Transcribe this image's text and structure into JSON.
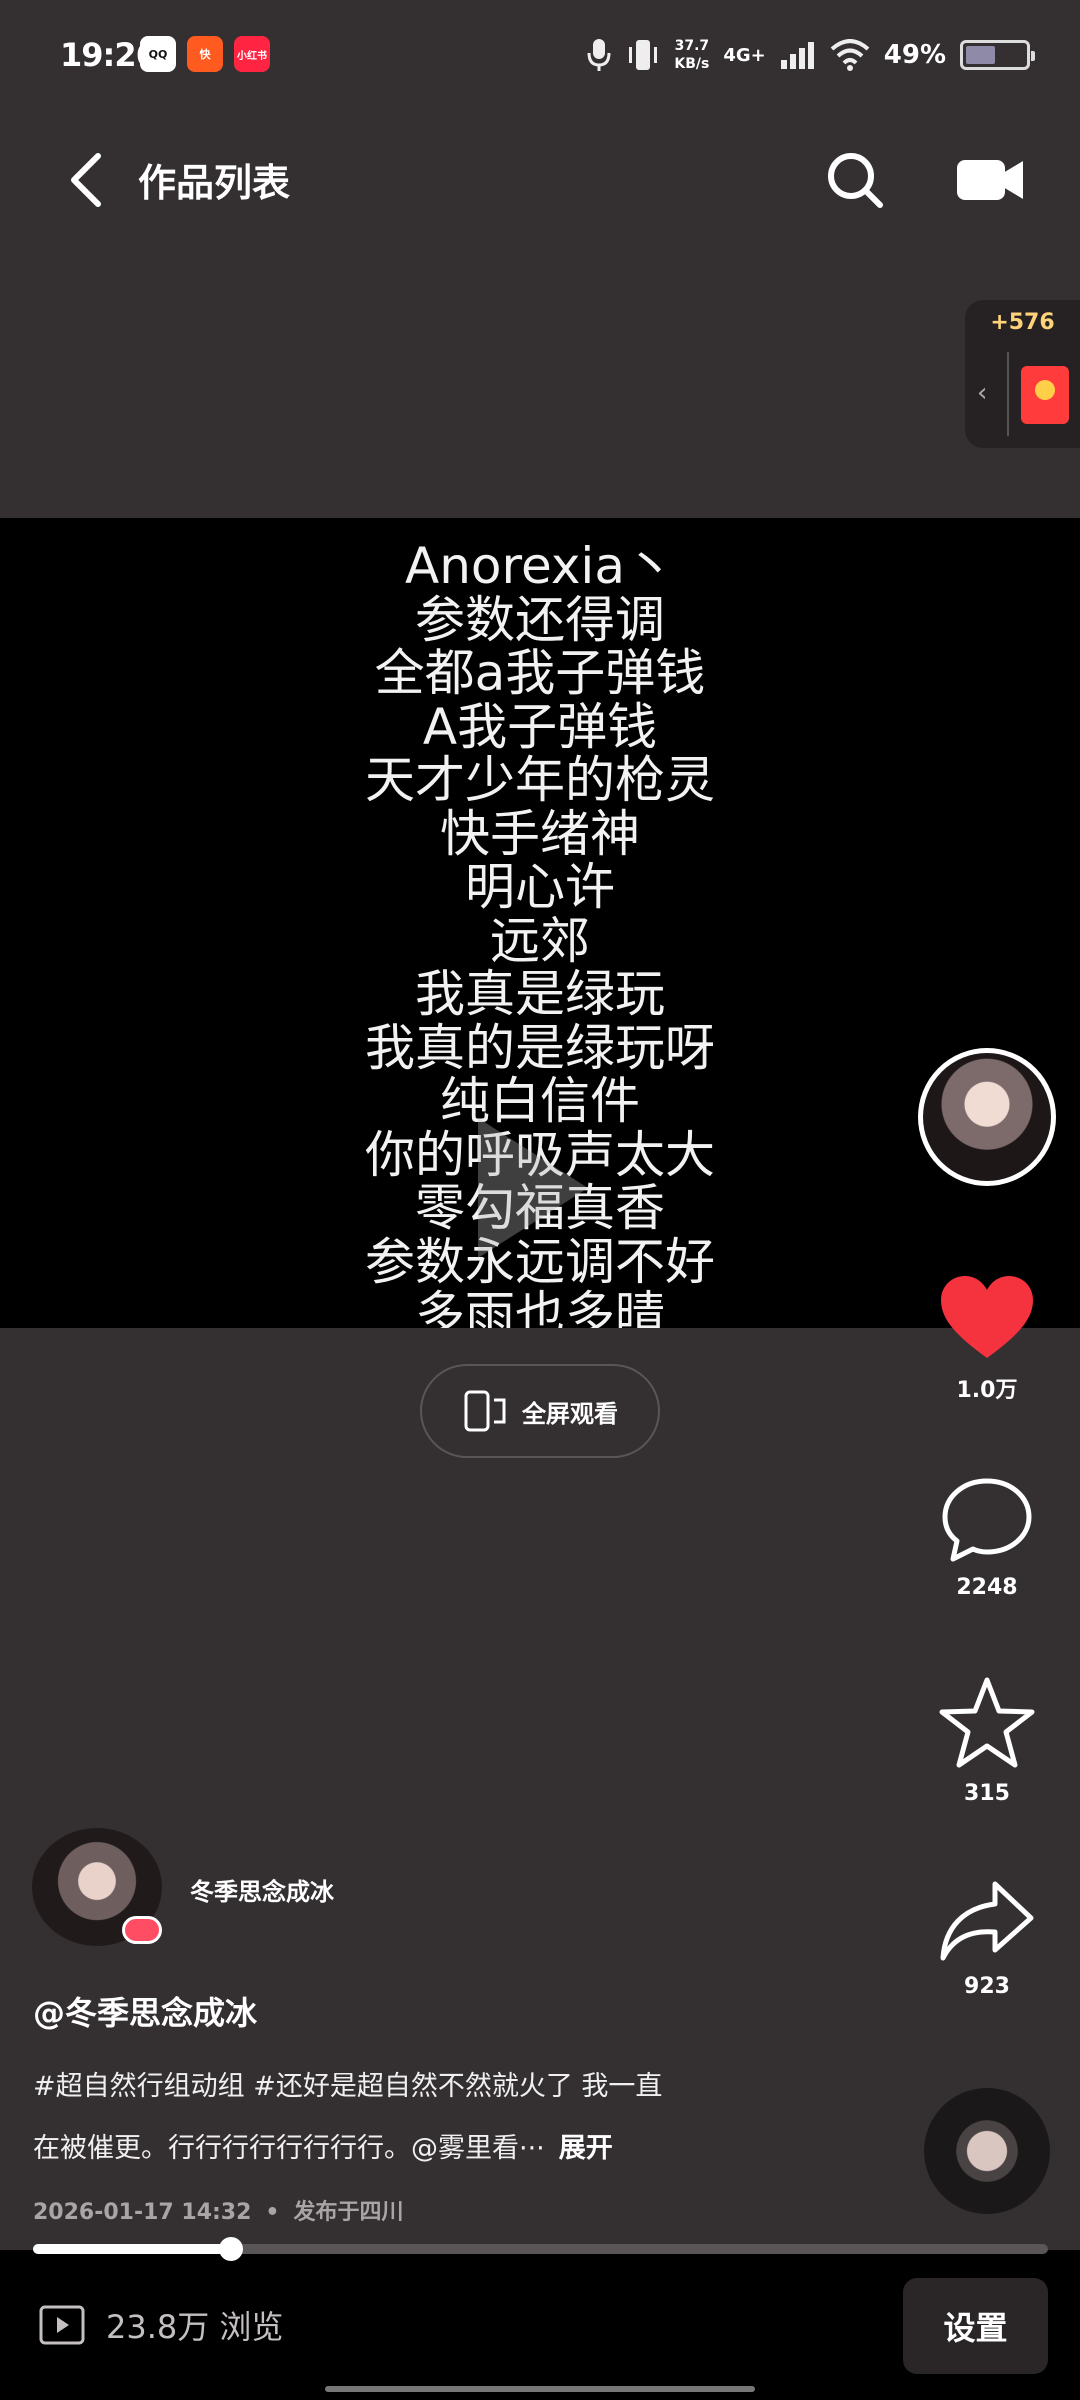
{
  "status_bar": {
    "time": "19:26",
    "apps": [
      "QQ",
      "快",
      "小红书"
    ],
    "net_speed_value": "37.7",
    "net_speed_unit": "KB/s",
    "network": "4G+",
    "battery": "49%"
  },
  "header": {
    "title": "作品列表"
  },
  "red_packet": {
    "count": "+576"
  },
  "video": {
    "lyrics": [
      "Anorexia丶",
      "参数还得调",
      "全都a我子弹钱",
      "A我子弹钱",
      "天才少年的枪灵",
      "快手绪神",
      "明心许",
      "远郊",
      "我真是绿玩",
      "我真的是绿玩呀",
      "纯白信件",
      "你的呼吸声太大",
      "零勾福真香",
      "参数永远调不好",
      "多雨也多晴"
    ]
  },
  "fullscreen": {
    "label": "全屏观看"
  },
  "actions": {
    "likes": "1.0万",
    "comments": "2248",
    "favorites": "315",
    "shares": "923"
  },
  "author": {
    "name": "冬季思念成冰",
    "handle": "@冬季思念成冰"
  },
  "description": {
    "line1": "#超自然行组动组 #还好是超自然不然就火了 我一直",
    "line2": "在被催更。行行行行行行行行。@雾里看···",
    "expand": "展开"
  },
  "meta": {
    "date": "2026-01-17 14:32",
    "separator": "•",
    "location": "发布于四川"
  },
  "playback": {
    "progress_fraction": 0.195
  },
  "bottom": {
    "views": "23.8万 浏览",
    "settings": "设置"
  },
  "colors": {
    "background": "#342f30",
    "like_red": "#f5333f",
    "accent_gold": "#ffd37a"
  }
}
